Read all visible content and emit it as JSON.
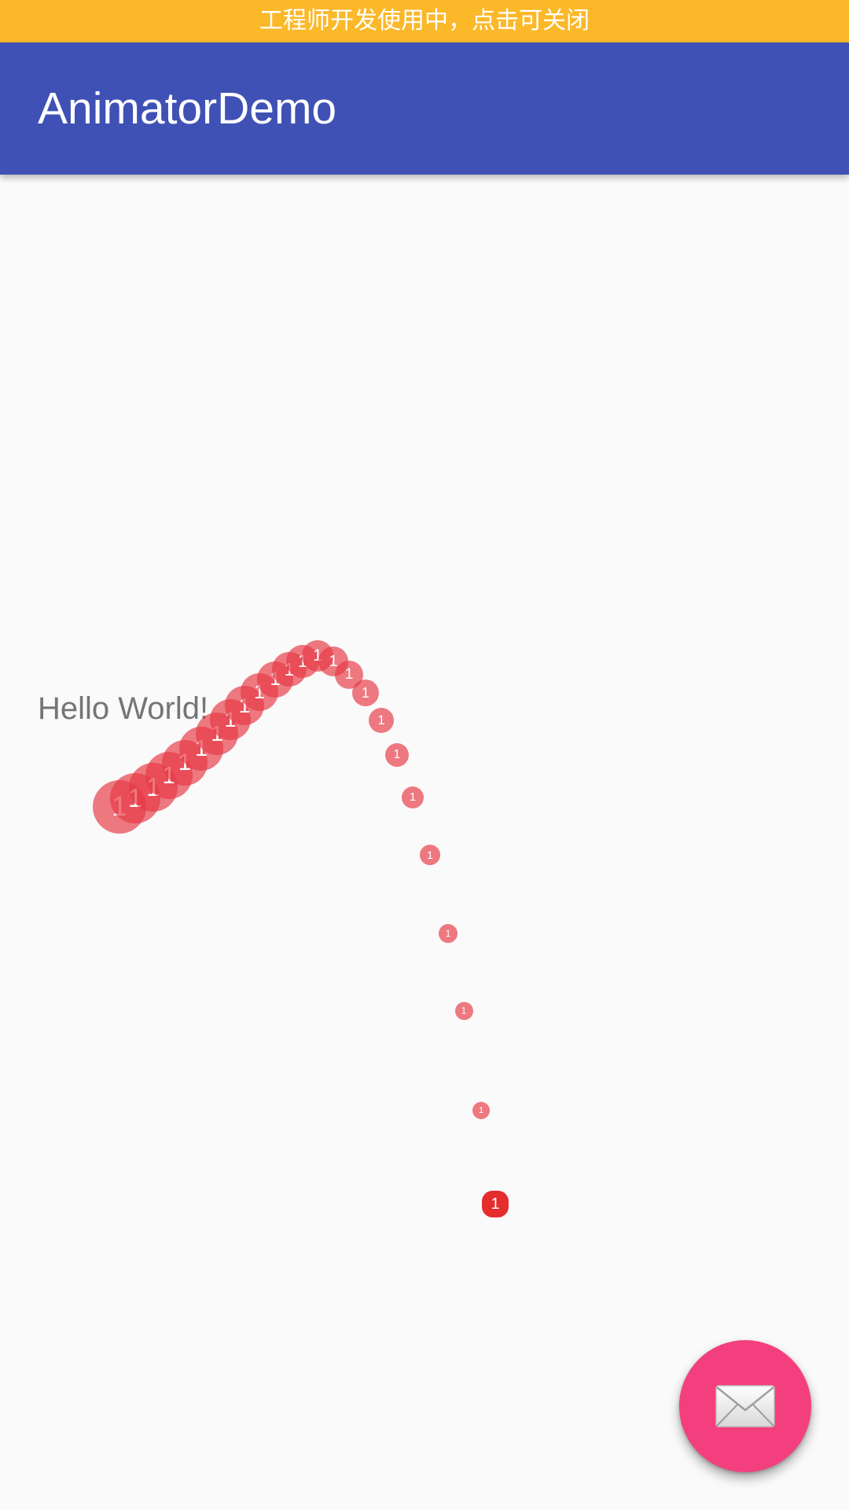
{
  "status_banner": {
    "text": "工程师开发使用中，点击可关闭"
  },
  "toolbar": {
    "title": "AnimatorDemo"
  },
  "content": {
    "hello_text": "Hello World!",
    "badge_label": "1"
  },
  "fab": {
    "icon": "mail-icon"
  },
  "colors": {
    "banner": "#fbb829",
    "toolbar": "#3f51b5",
    "badge": "#e63946",
    "fab": "#f43f7e"
  }
}
